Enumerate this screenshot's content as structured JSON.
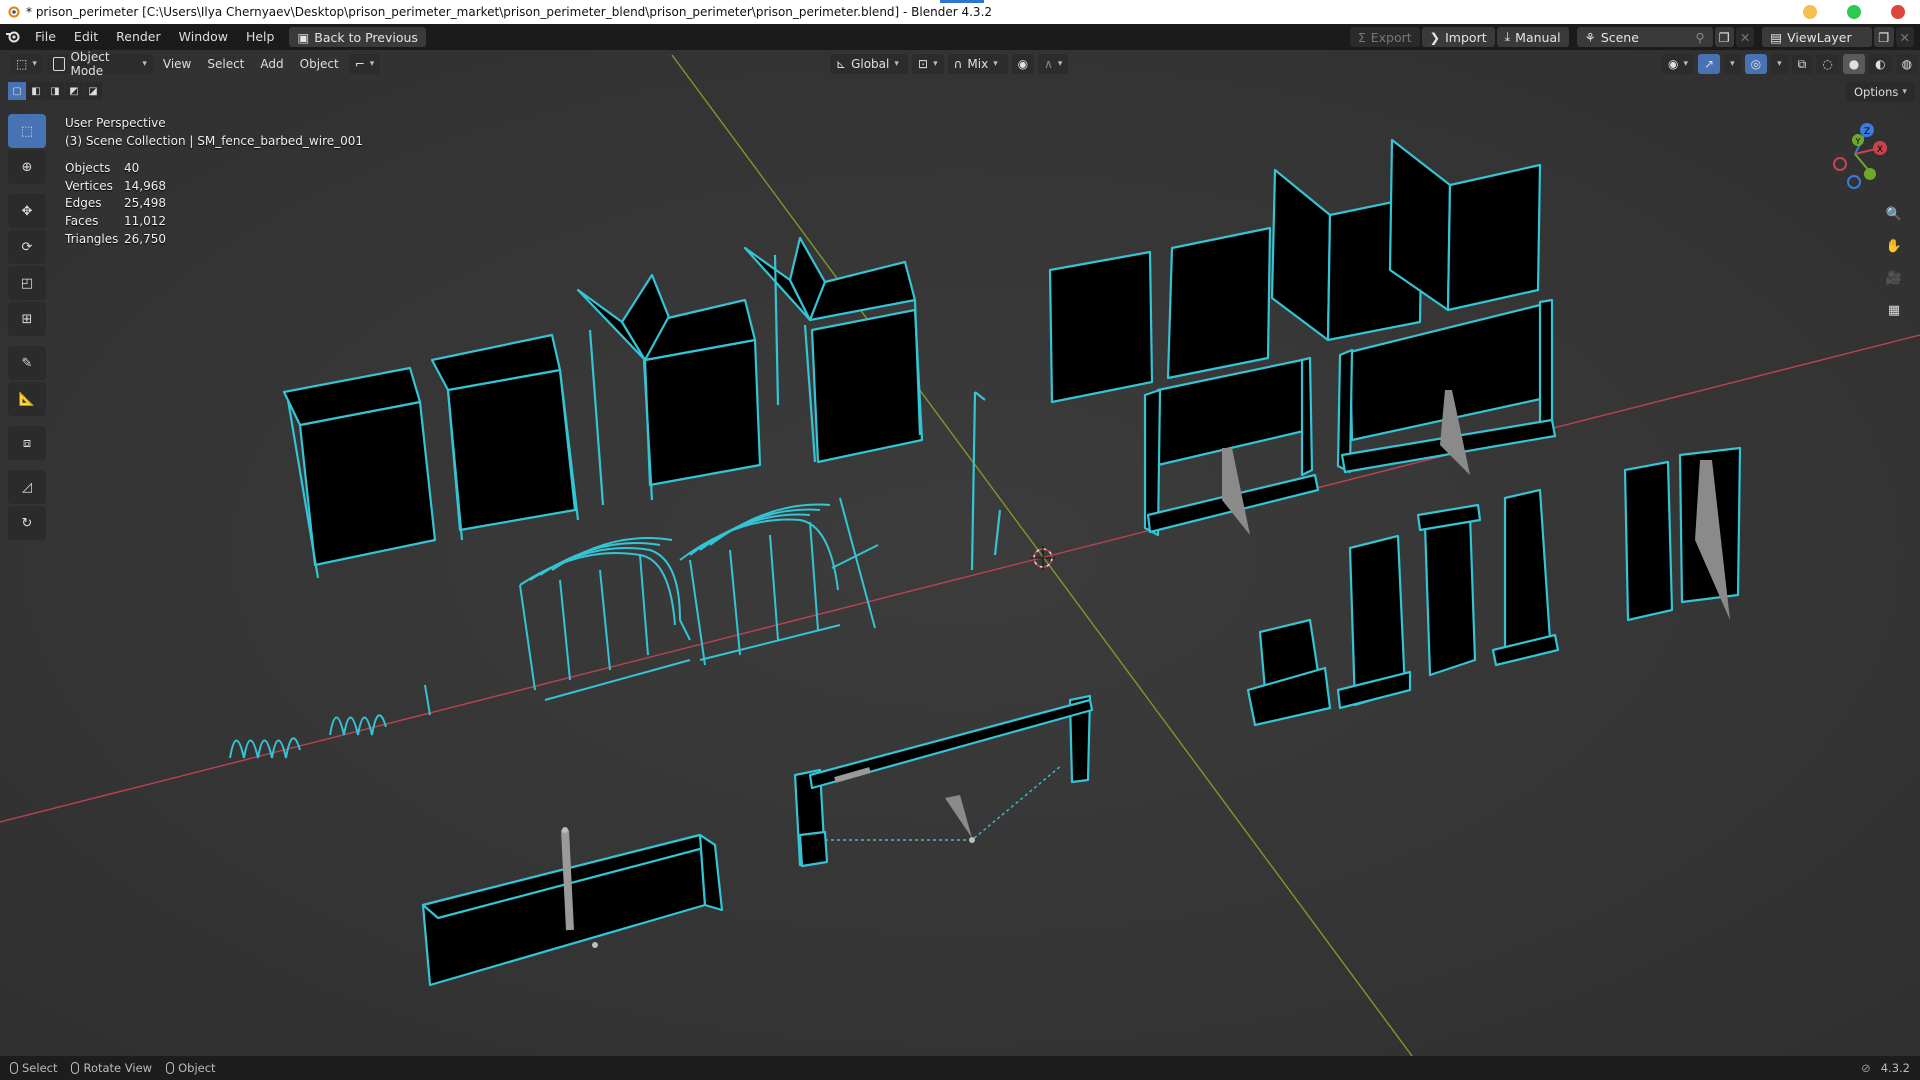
{
  "window": {
    "title": "* prison_perimeter [C:\\Users\\Ilya Chernyaev\\Desktop\\prison_perimeter_market\\prison_perimeter_blend\\prison_perimeter\\prison_perimeter.blend] - Blender 4.3.2",
    "controls": {
      "minimize": "#f4bf4f",
      "maximize": "#2ec950",
      "close": "#e0443e"
    }
  },
  "menubar": {
    "items": [
      "File",
      "Edit",
      "Render",
      "Window",
      "Help"
    ],
    "back_button": "Back to Previous",
    "export_label": "Export",
    "import_label": "Import",
    "manual_label": "Manual",
    "scene_label": "Scene",
    "viewlayer_label": "ViewLayer"
  },
  "viewport_header": {
    "mode": "Object Mode",
    "menus": [
      "View",
      "Select",
      "Add",
      "Object"
    ],
    "orientation": "Global",
    "snap": "Mix",
    "options_label": "Options"
  },
  "overlay": {
    "view_name": "User Perspective",
    "collection_line": "(3) Scene Collection | SM_fence_barbed_wire_001",
    "stats": [
      {
        "label": "Objects",
        "value": "40"
      },
      {
        "label": "Vertices",
        "value": "14,968"
      },
      {
        "label": "Edges",
        "value": "25,498"
      },
      {
        "label": "Faces",
        "value": "11,012"
      },
      {
        "label": "Triangles",
        "value": "26,750"
      }
    ]
  },
  "gizmo_axes": {
    "x": "X",
    "y": "Y",
    "z": "Z"
  },
  "statusbar": {
    "items": [
      "Select",
      "Rotate View",
      "Object"
    ],
    "version": "4.3.2"
  },
  "colors": {
    "accent": "#4772b3",
    "wire": "#35c4d4",
    "x_axis": "#c8424e",
    "y_axis": "#7a9a2a"
  }
}
